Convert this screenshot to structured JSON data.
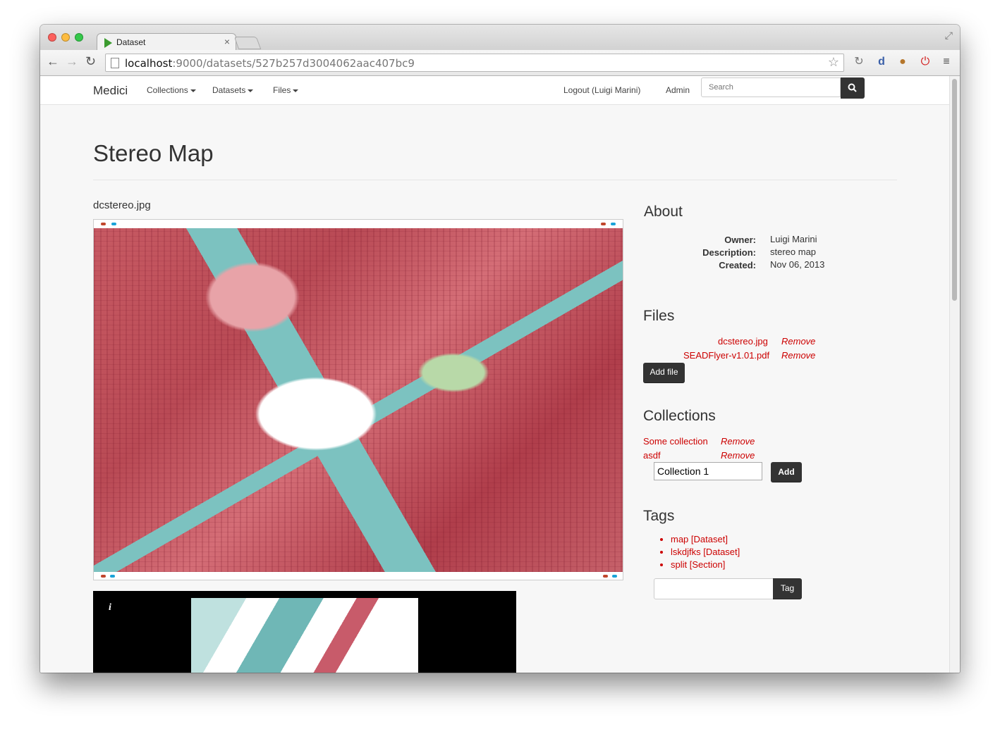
{
  "browser": {
    "tab_title": "Dataset",
    "url_host": "localhost",
    "url_path": ":9000/datasets/527b257d3004062aac407bc9"
  },
  "navbar": {
    "brand": "Medici",
    "collections": "Collections",
    "datasets": "Datasets",
    "files": "Files",
    "logout": "Logout (Luigi Marini)",
    "admin": "Admin",
    "search_placeholder": "Search"
  },
  "page": {
    "title": "Stereo Map",
    "file_name": "dcstereo.jpg"
  },
  "about": {
    "heading": "About",
    "owner_label": "Owner:",
    "owner": "Luigi Marini",
    "description_label": "Description:",
    "description": "stereo map",
    "created_label": "Created:",
    "created": "Nov 06, 2013"
  },
  "files": {
    "heading": "Files",
    "items": [
      {
        "name": "dcstereo.jpg",
        "remove": "Remove"
      },
      {
        "name": "SEADFlyer-v1.01.pdf",
        "remove": "Remove"
      }
    ],
    "add_file": "Add file"
  },
  "collections": {
    "heading": "Collections",
    "items": [
      {
        "name": "Some collection",
        "remove": "Remove"
      },
      {
        "name": "asdf",
        "remove": "Remove"
      }
    ],
    "input_value": "Collection 1",
    "add_button": "Add"
  },
  "tags": {
    "heading": "Tags",
    "items": [
      "map [Dataset]",
      "lskdjfks [Dataset]",
      "split [Section]"
    ],
    "tag_button": "Tag",
    "input_value": ""
  },
  "viewer": {
    "info_icon_label": "i"
  },
  "colors": {
    "link": "#cc0000",
    "button_dark": "#333333",
    "page_bg": "#f7f7f7"
  }
}
